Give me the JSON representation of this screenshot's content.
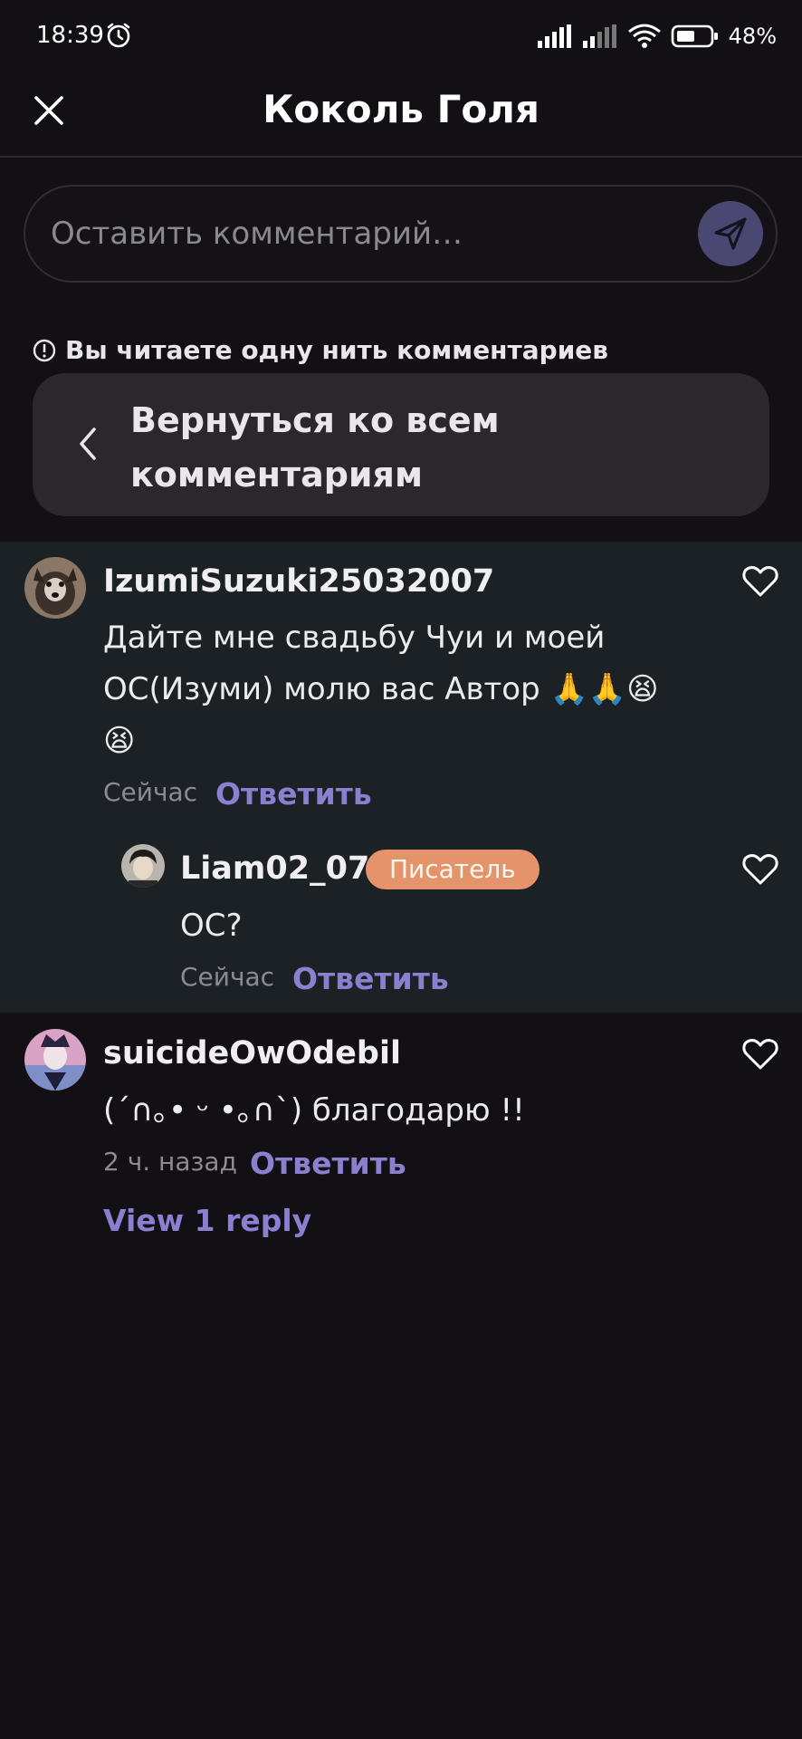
{
  "status_bar": {
    "time": "18:39",
    "battery_text": "48%"
  },
  "header": {
    "title": "Коколь Голя",
    "close_icon": "close-icon"
  },
  "comment_input": {
    "placeholder": "Оставить комментарий…",
    "send_icon": "send-icon"
  },
  "thread_notice": {
    "text": "Вы читаете одну нить комментариев",
    "back_label": "Вернуться ко всем комментариям"
  },
  "comments": [
    {
      "username": "IzumiSuzuki25032007",
      "body": "Дайте мне свадьбу Чуи и моей ОС(Изуми) молю вас Автор 🙏🙏😫 😫",
      "time": "Сейчас",
      "reply_label": "Ответить"
    },
    {
      "username": "Liam02_07",
      "badge": "Писатель",
      "body": "ОС?",
      "time": "Сейчас",
      "reply_label": "Ответить"
    },
    {
      "username": "suicideOwOdebil",
      "body": "(´∩｡• ᵕ •｡∩`) благодарю !!",
      "time": "2 ч. назад",
      "reply_label": "Ответить",
      "view_replies": "View 1 reply"
    }
  ],
  "colors": {
    "background": "#121014",
    "thread_background": "#1c2125",
    "accent": "#8b7fd0",
    "badge": "#e5936a",
    "send_button": "#4a4873"
  }
}
